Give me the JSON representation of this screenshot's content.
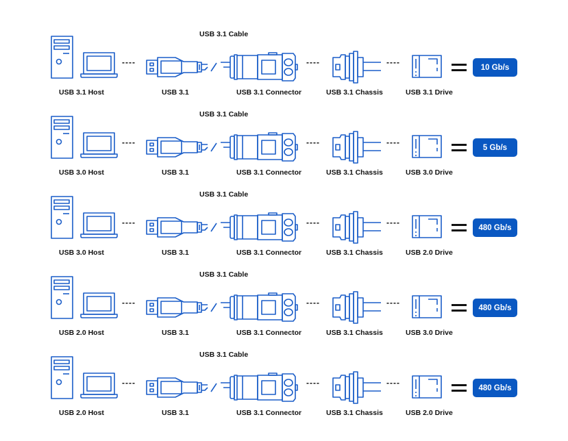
{
  "accent_color": "#0A58C2",
  "icons": [
    "desktop-tower-icon",
    "laptop-icon",
    "usb-plug-icon",
    "cable-break-icon",
    "usb-connector-icon",
    "usb-chassis-icon",
    "drive-icon",
    "equals-icon"
  ],
  "separator": "----",
  "rows": [
    {
      "cable_label": "USB 3.1 Cable",
      "host": "USB 3.1 Host",
      "plug": "USB 3.1",
      "connector": "USB 3.1 Connector",
      "chassis": "USB 3.1 Chassis",
      "drive": "USB 3.1 Drive",
      "speed": "10 Gb/s"
    },
    {
      "cable_label": "USB 3.1 Cable",
      "host": "USB 3.0 Host",
      "plug": "USB 3.1",
      "connector": "USB 3.1 Connector",
      "chassis": "USB 3.1 Chassis",
      "drive": "USB 3.0 Drive",
      "speed": "5 Gb/s"
    },
    {
      "cable_label": "USB 3.1 Cable",
      "host": "USB 3.0 Host",
      "plug": "USB 3.1",
      "connector": "USB 3.1 Connector",
      "chassis": "USB 3.1 Chassis",
      "drive": "USB 2.0 Drive",
      "speed": "480 Gb/s"
    },
    {
      "cable_label": "USB 3.1 Cable",
      "host": "USB 2.0 Host",
      "plug": "USB 3.1",
      "connector": "USB 3.1 Connector",
      "chassis": "USB 3.1 Chassis",
      "drive": "USB 3.0 Drive",
      "speed": "480 Gb/s"
    },
    {
      "cable_label": "USB 3.1 Cable",
      "host": "USB 2.0 Host",
      "plug": "USB 3.1",
      "connector": "USB 3.1 Connector",
      "chassis": "USB 3.1 Chassis",
      "drive": "USB 2.0 Drive",
      "speed": "480 Gb/s"
    }
  ]
}
